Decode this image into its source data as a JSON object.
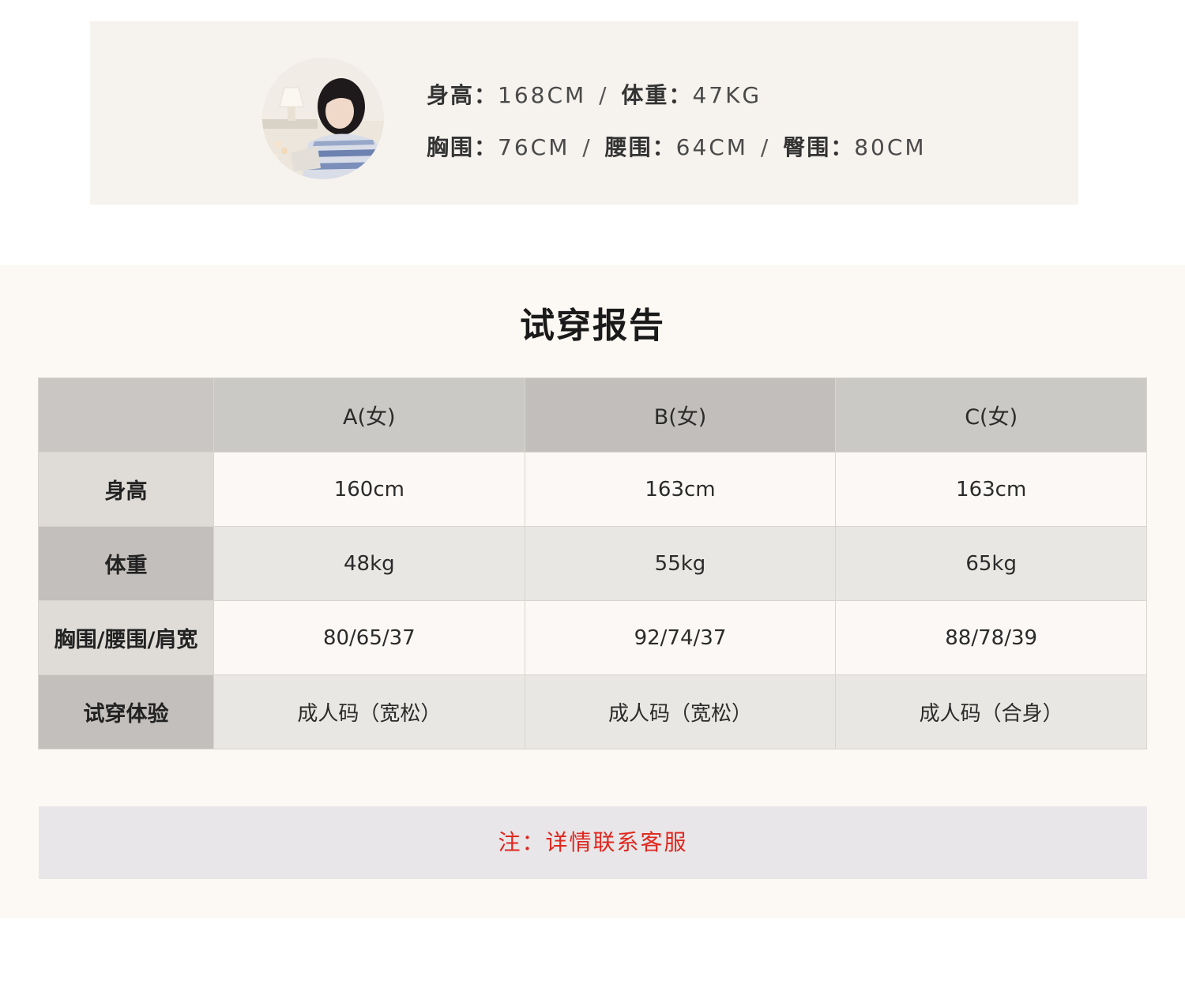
{
  "model": {
    "line1": {
      "height_label": "身高：",
      "height_value": "168CM",
      "weight_label": "体重：",
      "weight_value": "47KG"
    },
    "line2": {
      "bust_label": "胸围：",
      "bust_value": "76CM",
      "waist_label": "腰围：",
      "waist_value": "64CM",
      "hip_label": "臀围：",
      "hip_value": "80CM"
    },
    "separator": "/"
  },
  "report": {
    "title": "试穿报告",
    "columns": [
      "",
      "A(女)",
      "B(女)",
      "C(女)"
    ],
    "rows": [
      {
        "label": "身高",
        "values": [
          "160cm",
          "163cm",
          "163cm"
        ]
      },
      {
        "label": "体重",
        "values": [
          "48kg",
          "55kg",
          "65kg"
        ]
      },
      {
        "label": "胸围/腰围/肩宽",
        "values": [
          "80/65/37",
          "92/74/37",
          "88/78/39"
        ]
      },
      {
        "label": "试穿体验",
        "values": [
          "成人码（宽松）",
          "成人码（宽松）",
          "成人码（合身）"
        ]
      }
    ],
    "note": "注：详情联系客服"
  },
  "colors": {
    "note_text": "#e0261e",
    "card_bg": "#f6f3ee",
    "report_bg": "#fcf8f3"
  }
}
